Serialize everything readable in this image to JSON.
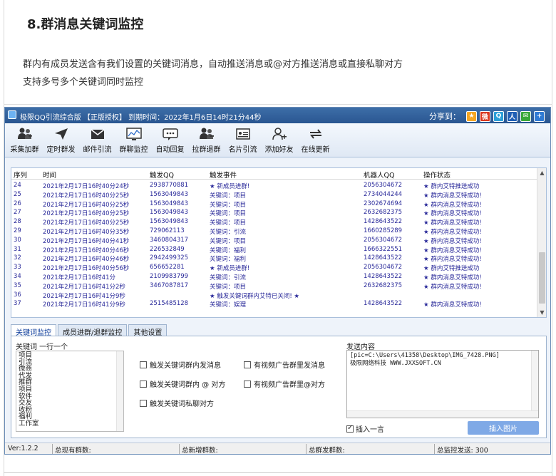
{
  "article": {
    "title": "8.群消息关键词监控",
    "para1": "群内有成员发送含有我们设置的关键词消息，自动推送消息或@对方推送消息或直接私聊对方",
    "para2": "支持多号多个关键词同时监控"
  },
  "window": {
    "title": "极限QQ引流综合版 【正版授权】 到期时间：2022年1月6日14时21分44秒",
    "share_label": "分享到：",
    "share_icons": [
      "qzone-icon",
      "weibo-icon",
      "tencent-weibo-icon",
      "renren-icon",
      "wechat-icon",
      "plus-icon"
    ]
  },
  "toolbar": [
    {
      "label": "采集加群",
      "icon": "add-group-icon"
    },
    {
      "label": "定时群发",
      "icon": "send-plane-icon"
    },
    {
      "label": "邮件引流",
      "icon": "mail-icon"
    },
    {
      "label": "群聊监控",
      "icon": "monitor-icon"
    },
    {
      "label": "自动回复",
      "icon": "chat-reply-icon"
    },
    {
      "label": "拉群退群",
      "icon": "group-pull-icon"
    },
    {
      "label": "名片引流",
      "icon": "card-icon"
    },
    {
      "label": "添加好友",
      "icon": "add-friend-icon"
    },
    {
      "label": "在线更新",
      "icon": "update-icon"
    }
  ],
  "log": {
    "headers": [
      "序列",
      "时间",
      "触发QQ",
      "触发事件",
      "机器人QQ",
      "操作状态"
    ],
    "rows": [
      [
        "24",
        "2021年2月17日16时40分24秒",
        "2938770881",
        "★ 新成员进群!",
        "2056304672",
        "★ 群内艾特推送成功"
      ],
      [
        "25",
        "2021年2月17日16时40分25秒",
        "1563049843",
        "关键词：项目",
        "2734044244",
        "★ 群内消息艾特成功!"
      ],
      [
        "26",
        "2021年2月17日16时40分25秒",
        "1563049843",
        "关键词：项目",
        "2302674694",
        "★ 群内消息艾特成功!"
      ],
      [
        "27",
        "2021年2月17日16时40分25秒",
        "1563049843",
        "关键词：项目",
        "2632682375",
        "★ 群内消息艾特成功!"
      ],
      [
        "28",
        "2021年2月17日16时40分25秒",
        "1563049843",
        "关键词：项目",
        "1428643522",
        "★ 群内消息艾特成功!"
      ],
      [
        "29",
        "2021年2月17日16时40分35秒",
        "729062113",
        "关键词：引流",
        "1660285289",
        "★ 群内消息艾特成功!"
      ],
      [
        "30",
        "2021年2月17日16时40分41秒",
        "3460804317",
        "关键词：项目",
        "2056304672",
        "★ 群内消息艾特成功!"
      ],
      [
        "31",
        "2021年2月17日16时40分46秒",
        "226532849",
        "关键词：福利",
        "1666322551",
        "★ 群内消息艾特成功!"
      ],
      [
        "32",
        "2021年2月17日16时40分46秒",
        "2942499325",
        "关键词：福利",
        "1428643522",
        "★ 群内消息艾特成功!"
      ],
      [
        "33",
        "2021年2月17日16时40分56秒",
        "656652281",
        "★ 新成员进群!",
        "2056304672",
        "★ 群内艾特推送成功"
      ],
      [
        "34",
        "2021年2月17日16时41分",
        "2109983799",
        "关键词：引流",
        "1428643522",
        "★ 群内消息艾特成功!"
      ],
      [
        "35",
        "2021年2月17日16时41分2秒",
        "3467087817",
        "关键词：项目",
        "2632682375",
        "★ 群内消息艾特成功!"
      ],
      [
        "36",
        "2021年2月17日16时41分9秒",
        "",
        "★ 触发关键词群内艾特已关闭! ★",
        "",
        ""
      ],
      [
        "37",
        "2021年2月17日16时41分9秒",
        "2515485128",
        "关键词：娱理",
        "1428643522",
        "★ 群内消息艾特成功!"
      ]
    ]
  },
  "tabs": [
    "关键词监控",
    "成员进群/退群监控",
    "其他设置"
  ],
  "panel": {
    "keyword_label": "关键词 一行一个",
    "keywords": [
      "项目",
      "引流",
      "微商",
      "代发",
      "推群",
      "项目",
      "软件",
      "交友",
      "收粉",
      "福利",
      "工作室"
    ],
    "checks": [
      {
        "label": "触发关键词群内发消息",
        "checked": false
      },
      {
        "label": "有视频广告群里发消息",
        "checked": false
      },
      {
        "label": "触发关键词群内 @ 对方",
        "checked": false
      },
      {
        "label": "有视频广告群里@对方",
        "checked": false
      },
      {
        "label": "触发关键词私聊对方",
        "checked": false
      }
    ],
    "send_label": "发送内容",
    "send_line1": "[pic=C:\\Users\\41358\\Desktop\\IMG_7428.PNG]",
    "send_line2": "极限网络科技 WWW.JXXSOFT.CN",
    "insert_check": "插入一言",
    "insert_button": "插入图片"
  },
  "status": {
    "version": "Ver:1.2.2",
    "total_groups": "总现有群数:",
    "new_groups": "总新增群数:",
    "group_sends": "总群发群数:",
    "monitor_sends": "总监控发送: 300"
  }
}
